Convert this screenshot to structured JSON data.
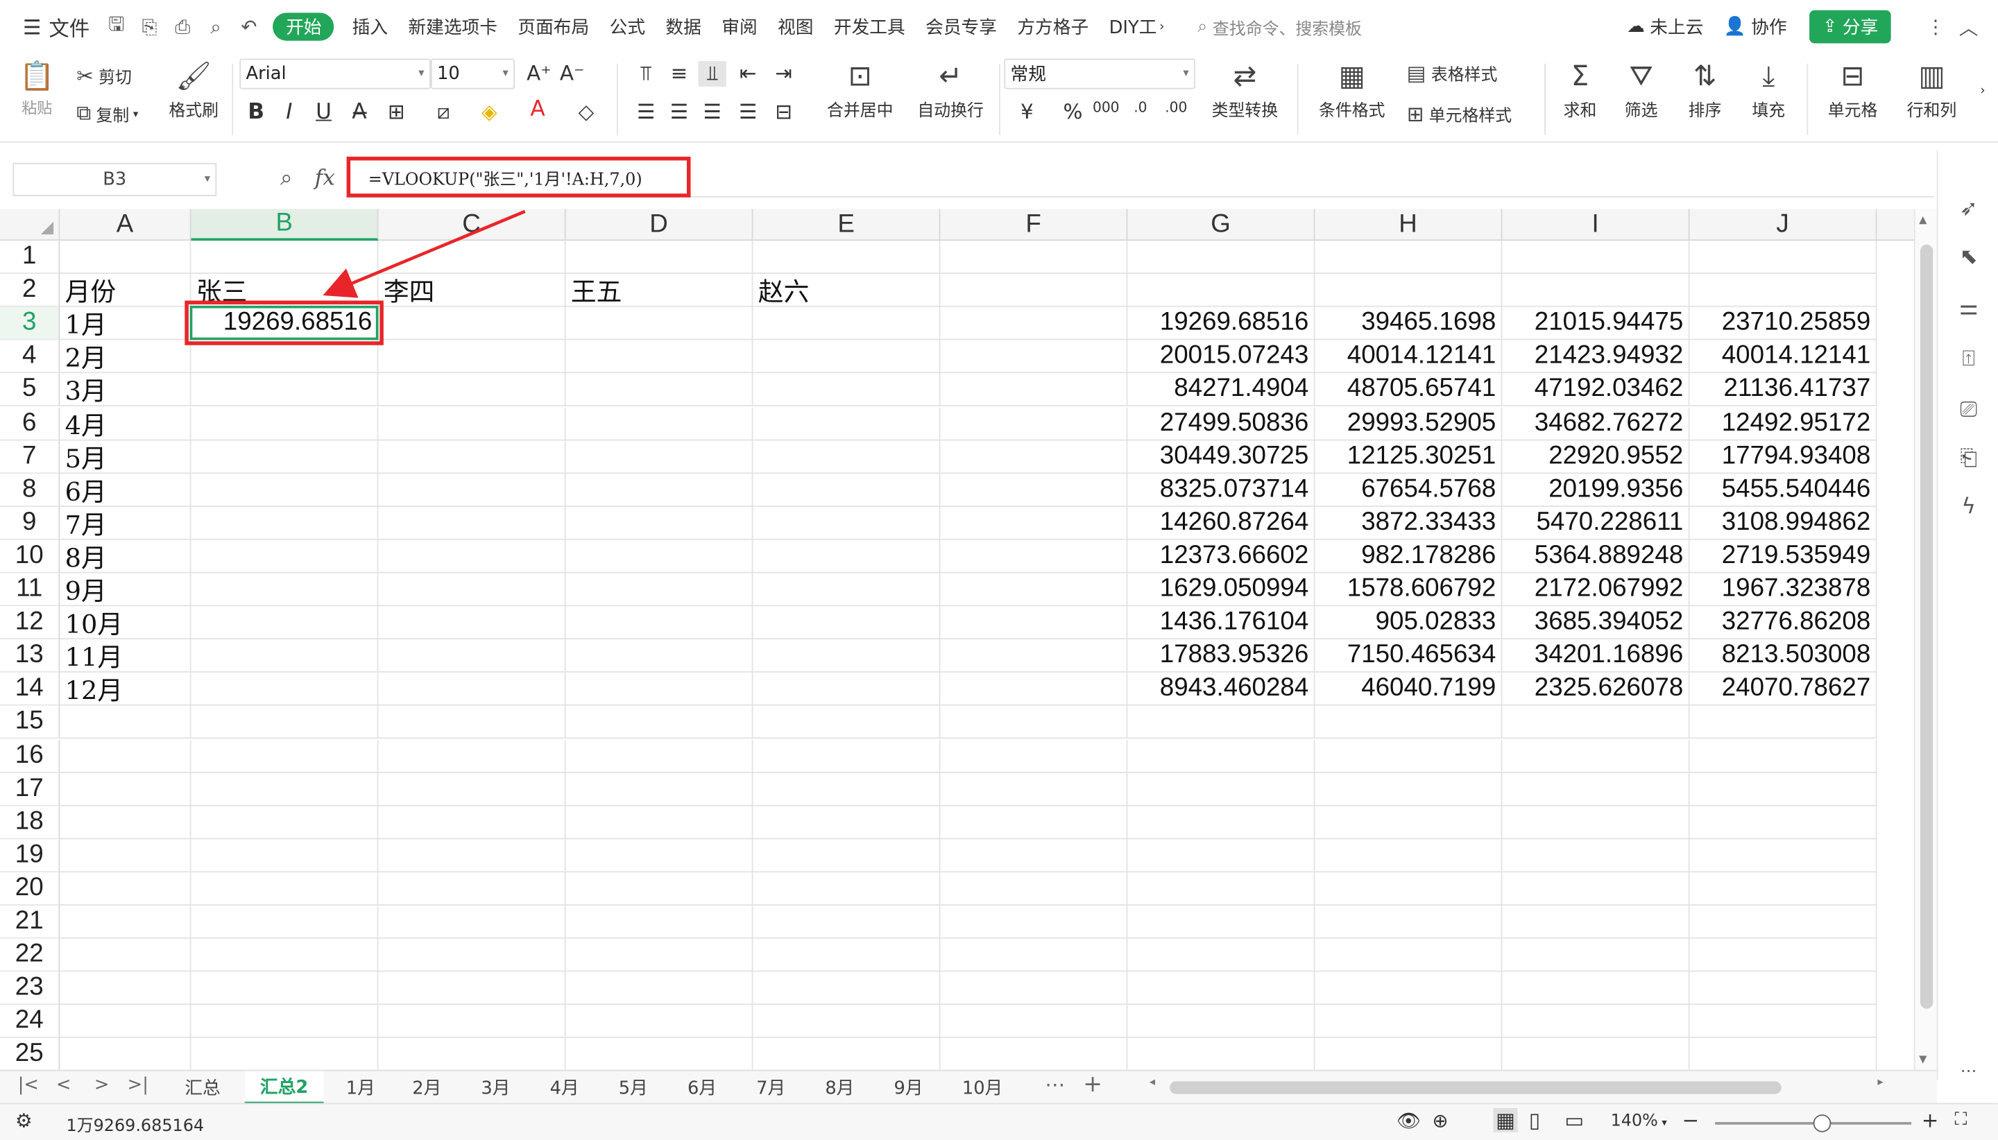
{
  "menu": {
    "file": "文件",
    "start": "开始",
    "tabs": [
      "插入",
      "新建选项卡",
      "页面布局",
      "公式",
      "数据",
      "审阅",
      "视图",
      "开发工具",
      "会员专享",
      "方方格子",
      "DIY工"
    ],
    "search_placeholder": "查找命令、搜索模板",
    "cloud": "未上云",
    "collab": "协作",
    "share": "分享"
  },
  "ribbon": {
    "paste": "粘贴",
    "cut": "剪切",
    "copy": "复制",
    "format_painter": "格式刷",
    "font_name": "Arial",
    "font_size": "10",
    "merge_center": "合并居中",
    "wrap_text": "自动换行",
    "number_format": "常规",
    "type_convert": "类型转换",
    "cond_format": "条件格式",
    "table_style": "表格样式",
    "cell_style": "单元格样式",
    "sum": "求和",
    "filter": "筛选",
    "sort": "排序",
    "fill": "填充",
    "cell": "单元格",
    "row_col": "行和列"
  },
  "formula_bar": {
    "name_box": "B3",
    "fx": "fx",
    "formula": "=VLOOKUP(\"张三\",'1月'!A:H,7,0)"
  },
  "columns": [
    "A",
    "B",
    "C",
    "D",
    "E",
    "F",
    "G",
    "H",
    "I",
    "J"
  ],
  "rows": [
    "1",
    "2",
    "3",
    "4",
    "5",
    "6",
    "7",
    "8",
    "9",
    "10",
    "11",
    "12",
    "13",
    "14",
    "15",
    "16",
    "17",
    "18",
    "19",
    "20",
    "21",
    "22",
    "23",
    "24",
    "25"
  ],
  "header_row": [
    "月份",
    "张三",
    "李四",
    "王五",
    "赵六"
  ],
  "months": [
    "1月",
    "2月",
    "3月",
    "4月",
    "5月",
    "6月",
    "7月",
    "8月",
    "9月",
    "10月",
    "11月",
    "12月"
  ],
  "b3_value": "19269.68516",
  "table": [
    [
      "19269.68516",
      "39465.1698",
      "21015.94475",
      "23710.25859"
    ],
    [
      "20015.07243",
      "40014.12141",
      "21423.94932",
      "40014.12141"
    ],
    [
      "84271.4904",
      "48705.65741",
      "47192.03462",
      "21136.41737"
    ],
    [
      "27499.50836",
      "29993.52905",
      "34682.76272",
      "12492.95172"
    ],
    [
      "30449.30725",
      "12125.30251",
      "22920.9552",
      "17794.93408"
    ],
    [
      "8325.073714",
      "67654.5768",
      "20199.9356",
      "5455.540446"
    ],
    [
      "14260.87264",
      "3872.33433",
      "5470.228611",
      "3108.994862"
    ],
    [
      "12373.66602",
      "982.178286",
      "5364.889248",
      "2719.535949"
    ],
    [
      "1629.050994",
      "1578.606792",
      "2172.067992",
      "1967.323878"
    ],
    [
      "1436.176104",
      "905.02833",
      "3685.394052",
      "32776.86208"
    ],
    [
      "17883.95326",
      "7150.465634",
      "34201.16896",
      "8213.503008"
    ],
    [
      "8943.460284",
      "46040.7199",
      "2325.626078",
      "24070.78627"
    ]
  ],
  "sheet_tabs": [
    "汇总",
    "汇总2",
    "1月",
    "2月",
    "3月",
    "4月",
    "5月",
    "6月",
    "7月",
    "8月",
    "9月",
    "10月"
  ],
  "active_sheet": "汇总2",
  "status": {
    "value": "1万9269.685164",
    "zoom": "140%"
  },
  "accent": "#21a366",
  "highlight": "#e8262a"
}
